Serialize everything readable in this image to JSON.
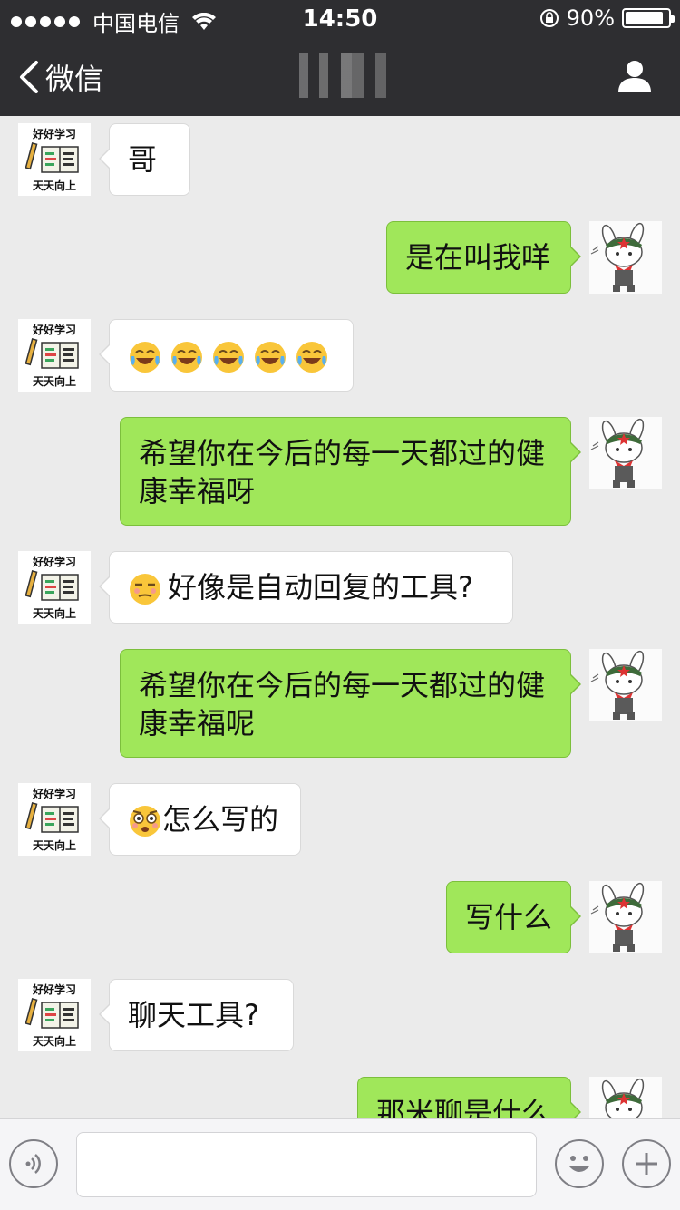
{
  "status_bar": {
    "carrier": "中国电信",
    "time": "14:50",
    "battery_text": "90%",
    "battery_level": 0.9
  },
  "nav": {
    "back_label": "微信"
  },
  "avatars": {
    "friend_top": "好好学习",
    "friend_bottom": "天天向上"
  },
  "messages": [
    {
      "side": "left",
      "text": "哥"
    },
    {
      "side": "right",
      "text": "是在叫我咩"
    },
    {
      "side": "left",
      "text": "",
      "emojis": [
        "tears-of-joy",
        "tears-of-joy",
        "tears-of-joy",
        "tears-of-joy",
        "tears-of-joy"
      ]
    },
    {
      "side": "right",
      "lines": [
        "希望你在今后的每一天都过的健",
        "康幸福呀"
      ]
    },
    {
      "side": "left",
      "text": "好像是自动回复的工具?",
      "emoji": "unamused"
    },
    {
      "side": "right",
      "lines": [
        "希望你在今后的每一天都过的健",
        "康幸福呢"
      ]
    },
    {
      "side": "left",
      "text": "怎么写的",
      "emoji": "flushed-face"
    },
    {
      "side": "right",
      "text": "写什么"
    },
    {
      "side": "left",
      "text": "聊天工具?"
    },
    {
      "side": "right",
      "text": "那米聊是什么"
    }
  ],
  "input": {
    "voice_icon": "voice-icon",
    "emoji_icon": "emoji-icon",
    "plus_icon": "plus-icon"
  },
  "colors": {
    "nav_bg": "#2e2e31",
    "chat_bg": "#ebebeb",
    "bubble_sent": "#a0e75a",
    "bubble_received": "#ffffff"
  }
}
